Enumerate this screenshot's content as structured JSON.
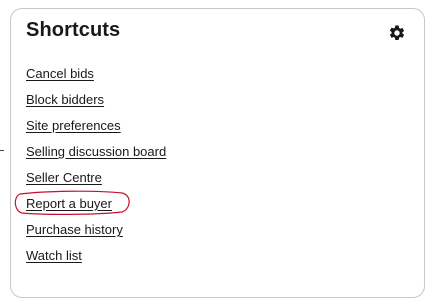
{
  "panel": {
    "title": "Shortcuts",
    "settings_icon": "gear-icon"
  },
  "links": [
    {
      "label": "Cancel bids"
    },
    {
      "label": "Block bidders"
    },
    {
      "label": "Site preferences"
    },
    {
      "label": "Selling discussion board"
    },
    {
      "label": "Seller Centre"
    },
    {
      "label": "Report a buyer",
      "highlighted": true
    },
    {
      "label": "Purchase history"
    },
    {
      "label": "Watch list"
    }
  ],
  "colors": {
    "text": "#191919",
    "border": "#c7c7c7",
    "annotation": "#c8102e"
  }
}
